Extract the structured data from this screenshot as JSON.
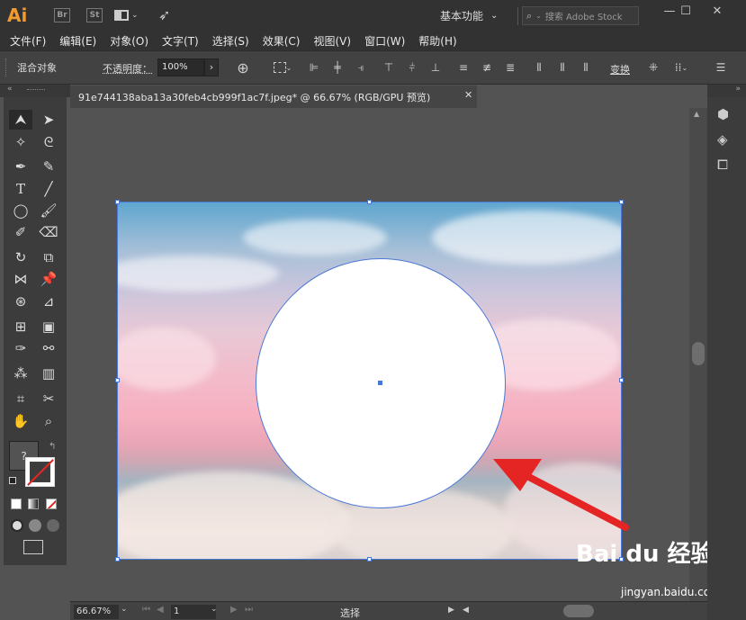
{
  "app": {
    "logo": "Ai",
    "bridge": "Br",
    "stock": "St",
    "workspace": "基本功能",
    "search_placeholder": "搜索 Adobe Stock",
    "window_buttons": [
      "—",
      "☐",
      "✕"
    ]
  },
  "menu": [
    "文件(F)",
    "编辑(E)",
    "对象(O)",
    "文字(T)",
    "选择(S)",
    "效果(C)",
    "视图(V)",
    "窗口(W)",
    "帮助(H)"
  ],
  "control": {
    "mode": "混合对象",
    "opacity_label": "不透明度：",
    "opacity_value": "100%",
    "transform": "变换"
  },
  "document": {
    "tab_title": "91e744138aba13a30feb4cb999f1ac7f.jpeg* @ 66.67% (RGB/GPU 预览)",
    "close": "✕"
  },
  "status": {
    "zoom": "66.67%",
    "page": "1",
    "tool": "选择"
  },
  "watermark": {
    "logo": "Bai du 经验",
    "url": "jingyan.baidu.com"
  },
  "colors": {
    "accent_logo": "#f29a2e",
    "selection": "#4a78d6",
    "arrow": "#e52524"
  }
}
